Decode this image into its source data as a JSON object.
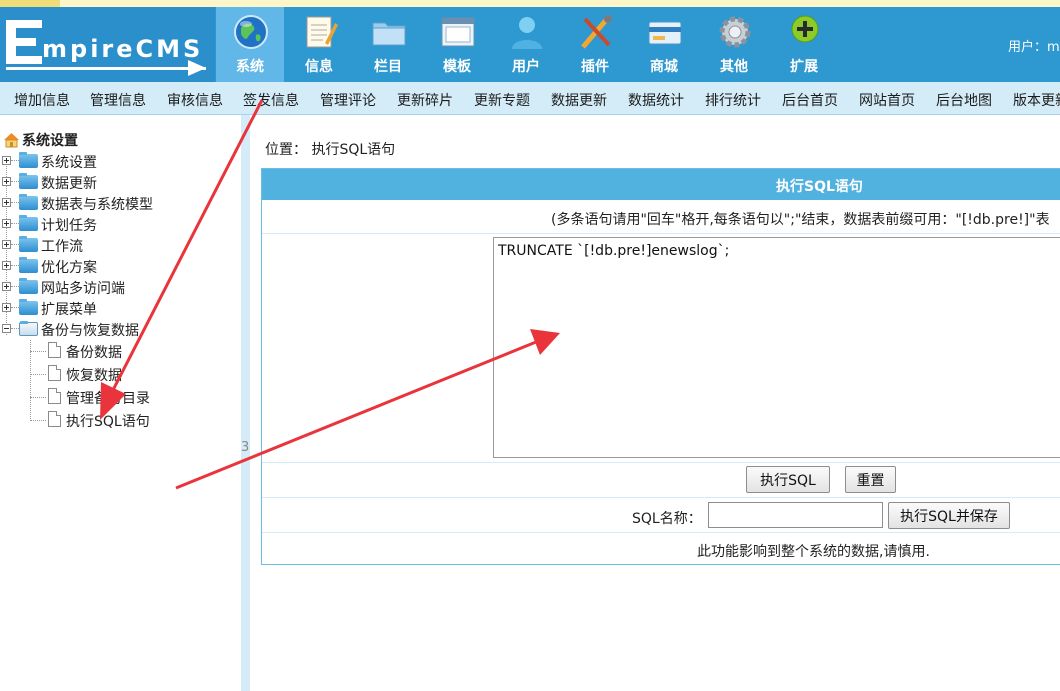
{
  "header": {
    "logo_text": "mpireCMS",
    "logo_initial": "E",
    "user_label": "用户：m",
    "accent": "#2e98d1",
    "nav": [
      {
        "label": "系统",
        "icon": "globe-icon",
        "active": true
      },
      {
        "label": "信息",
        "icon": "notepad-icon"
      },
      {
        "label": "栏目",
        "icon": "folder-icon"
      },
      {
        "label": "模板",
        "icon": "window-icon"
      },
      {
        "label": "用户",
        "icon": "person-icon"
      },
      {
        "label": "插件",
        "icon": "tools-icon"
      },
      {
        "label": "商城",
        "icon": "card-icon"
      },
      {
        "label": "其他",
        "icon": "gear-icon"
      },
      {
        "label": "扩展",
        "icon": "plus-circle-icon"
      }
    ]
  },
  "submenu": [
    "增加信息",
    "管理信息",
    "审核信息",
    "签发信息",
    "管理评论",
    "更新碎片",
    "更新专题",
    "数据更新",
    "数据统计",
    "排行统计",
    "后台首页",
    "网站首页",
    "后台地图",
    "版本更新"
  ],
  "tree": {
    "root": "系统设置",
    "folders": [
      "系统设置",
      "数据更新",
      "数据表与系统模型",
      "计划任务",
      "工作流",
      "优化方案",
      "网站多访问端",
      "扩展菜单",
      "备份与恢复数据"
    ],
    "leaves": [
      "备份数据",
      "恢复数据",
      "管理备份目录",
      "执行SQL语句"
    ]
  },
  "main": {
    "location_prefix": "位置：",
    "location_link": "执行SQL语句",
    "panel_title": "执行SQL语句",
    "hint": "(多条语句请用\"回车\"格开,每条语句以\";\"结束，数据表前缀可用：\"[!db.pre!]\"表",
    "sql_value": "TRUNCATE `[!db.pre!]enewslog`;",
    "exec_button": "执行SQL",
    "reset_button": "重置",
    "sqlname_label": "SQL名称：",
    "sqlname_value": "",
    "exec_save_button": "执行SQL并保存",
    "warning": "此功能影响到整个系统的数据,请慎用.",
    "stray_text": "3"
  },
  "annotation_color": "#e8343a"
}
